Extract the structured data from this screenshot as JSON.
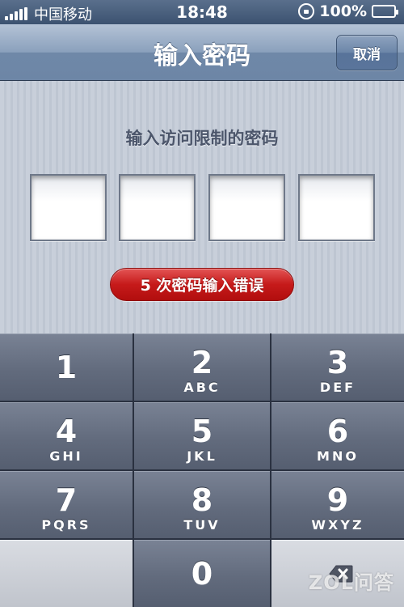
{
  "status_bar": {
    "carrier": "中国移动",
    "time": "18:48",
    "battery": "100%",
    "battery_level": 1.0
  },
  "nav": {
    "title": "输入密码",
    "cancel_label": "取消"
  },
  "content": {
    "prompt": "输入访问限制的密码",
    "error": "5 次密码输入错误"
  },
  "keypad": {
    "keys": [
      {
        "num": "1",
        "letters": ""
      },
      {
        "num": "2",
        "letters": "ABC"
      },
      {
        "num": "3",
        "letters": "DEF"
      },
      {
        "num": "4",
        "letters": "GHI"
      },
      {
        "num": "5",
        "letters": "JKL"
      },
      {
        "num": "6",
        "letters": "MNO"
      },
      {
        "num": "7",
        "letters": "PQRS"
      },
      {
        "num": "8",
        "letters": "TUV"
      },
      {
        "num": "9",
        "letters": "WXYZ"
      },
      {
        "num": "0",
        "letters": ""
      }
    ]
  },
  "watermark": "ZOL问答",
  "icons": {
    "signal": "signal-icon",
    "rotation_lock": "rotation-lock-icon",
    "battery": "battery-icon",
    "delete": "delete-backspace-icon"
  }
}
